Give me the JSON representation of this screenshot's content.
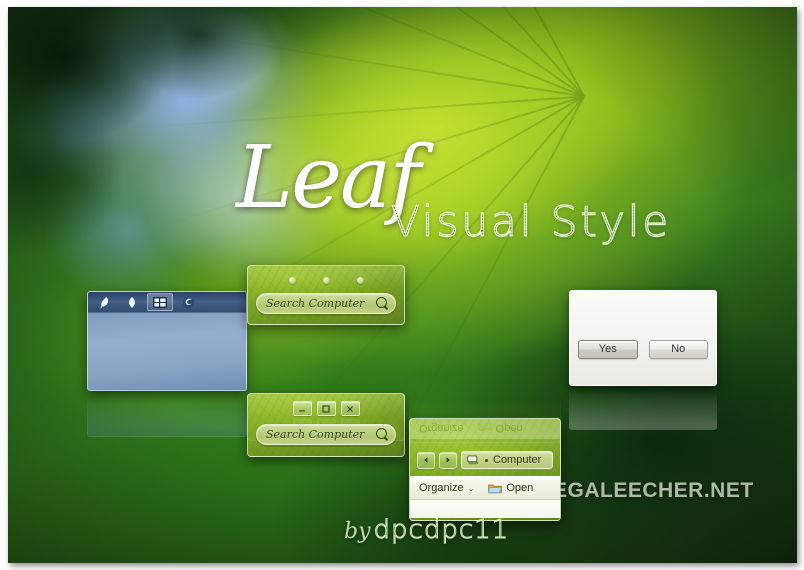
{
  "poster": {
    "theme_title": "Leaf",
    "theme_subtitle": "Visual Style",
    "byline_prefix": "by",
    "byline_author": "dpcdpc11",
    "watermark": "MEGALEECHER.NET",
    "accent_green": "#90b829",
    "accent_light_green": "#c4e230",
    "taskbar_blue": "#93aece",
    "dialog_gray": "#f2f2ee"
  },
  "taskbar_window": {
    "name": "taskbar-preview",
    "items": [
      {
        "icon": "feather-icon",
        "label": "",
        "active": false
      },
      {
        "icon": "leaf-icon",
        "label": "",
        "active": false
      },
      {
        "icon": "windows-explorer-icon",
        "label": "",
        "active": true
      },
      {
        "icon": "firefox-icon",
        "label": "",
        "active": false
      }
    ]
  },
  "search_window_a": {
    "name": "search-window-unpressed",
    "caption_buttons": [
      {
        "icon": "minimize-dot-icon"
      },
      {
        "icon": "maximize-dot-icon"
      },
      {
        "icon": "close-dot-icon"
      }
    ],
    "search": {
      "placeholder": "Search Computer",
      "icon": "magnifier-icon"
    }
  },
  "search_window_b": {
    "name": "search-window-with-caption-buttons",
    "caption_buttons": [
      {
        "icon": "minimize-icon",
        "glyph": "minimize"
      },
      {
        "icon": "maximize-icon",
        "glyph": "maximize"
      },
      {
        "icon": "close-icon",
        "glyph": "close"
      }
    ],
    "search": {
      "placeholder": "Search Computer",
      "icon": "magnifier-icon"
    }
  },
  "explorer_window": {
    "name": "explorer-preview",
    "nav": {
      "back_icon": "back-arrow-icon",
      "forward_icon": "forward-arrow-icon"
    },
    "address_bar": {
      "location_icon": "computer-icon",
      "separator_icon": "breadcrumb-separator-icon",
      "crumb": "Computer"
    },
    "toolbar": [
      {
        "label": "Organize",
        "icon": "",
        "chevron": "⌄"
      },
      {
        "label": "Open",
        "icon": "folder-open-icon",
        "chevron": ""
      }
    ]
  },
  "dialog_window": {
    "name": "confirm-dialog-preview",
    "buttons": [
      {
        "label": "Yes",
        "focused": true
      },
      {
        "label": "No",
        "focused": false
      }
    ]
  }
}
